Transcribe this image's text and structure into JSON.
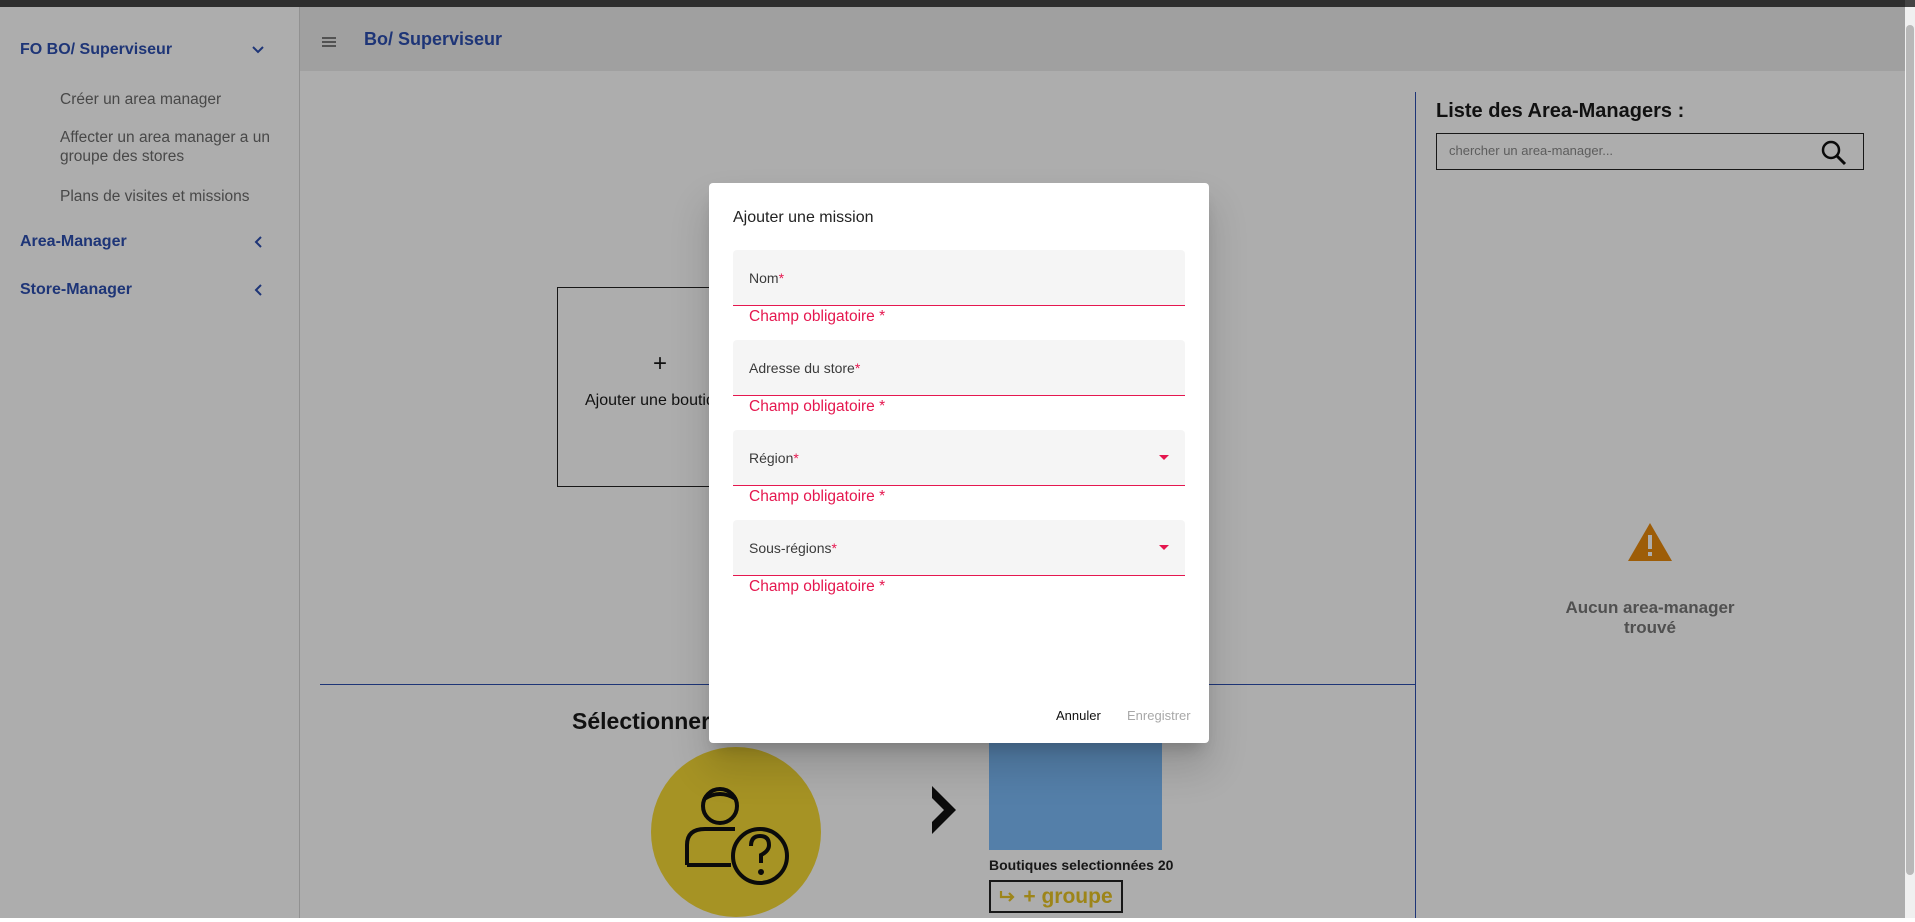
{
  "sidebar": {
    "groups": [
      {
        "label": "FO BO/ Superviseur",
        "expanded": true
      },
      {
        "label": "Area-Manager",
        "expanded": false
      },
      {
        "label": "Store-Manager",
        "expanded": false
      }
    ],
    "sub_items": [
      "Créer un area manager",
      "Affecter un area manager a un groupe des stores",
      "Plans de visites et missions"
    ]
  },
  "header": {
    "title": "Bo/ Superviseur",
    "menu_icon": "menu-icon"
  },
  "main": {
    "add_card": {
      "plus": "+",
      "label": "Ajouter une boutique"
    },
    "select_title": "Sélectionner",
    "selected_stores": "Boutiques selectionnées 20",
    "group_button": "+ groupe"
  },
  "right_panel": {
    "title": "Liste des Area-Managers :",
    "search_placeholder": "chercher un area-manager...",
    "empty_text": "Aucun area-manager trouvé"
  },
  "dialog": {
    "title": "Ajouter une mission",
    "fields": [
      {
        "label": "Nom",
        "required": "*",
        "type": "text",
        "error": "Champ obligatoire *"
      },
      {
        "label": "Adresse du store",
        "required": "*",
        "type": "text",
        "error": "Champ obligatoire *"
      },
      {
        "label": "Région",
        "required": "*",
        "type": "select",
        "error": "Champ obligatoire *"
      },
      {
        "label": "Sous-régions",
        "required": "*",
        "type": "select",
        "error": "Champ obligatoire *"
      }
    ],
    "cancel_label": "Annuler",
    "save_label": "Enregistrer"
  },
  "colors": {
    "brand_blue": "#2d4fb0",
    "error": "#e5174f",
    "accent_yellow": "#f5d936",
    "warning": "#e8890c",
    "store_box": "#7cbcfa"
  }
}
